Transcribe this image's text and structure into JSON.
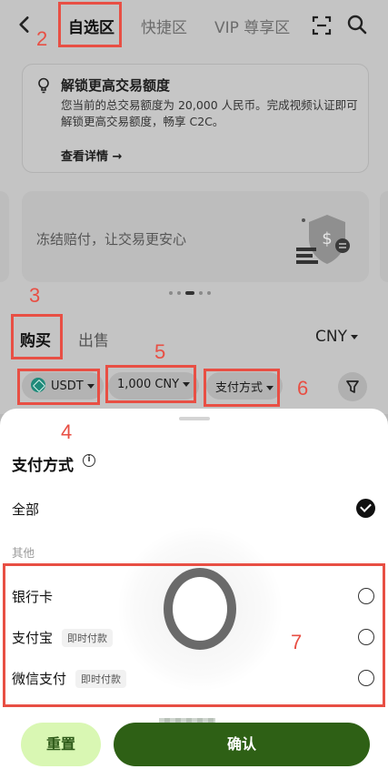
{
  "header": {
    "tabs": [
      {
        "label": "自选区",
        "active": true
      },
      {
        "label": "快捷区",
        "active": false
      },
      {
        "label": "VIP 尊享区",
        "active": false
      }
    ]
  },
  "notice": {
    "title": "解锁更高交易额度",
    "body": "您当前的总交易额度为 20,000 人民币。完成视频认证即可解锁更高交易额度，畅享 C2C。",
    "link": "查看详情 →"
  },
  "banner": {
    "text": "冻结赔付，让交易更安心",
    "page_count": 5,
    "active_page": 1
  },
  "trade": {
    "tabs": [
      {
        "label": "购买",
        "active": true
      },
      {
        "label": "出售",
        "active": false
      }
    ],
    "currency": "CNY"
  },
  "filters": {
    "coin": "USDT",
    "amount": "1,000 CNY",
    "payment": "支付方式"
  },
  "annotations": [
    "2",
    "3",
    "5",
    "6",
    "4",
    "7"
  ],
  "sheet": {
    "title": "支付方式",
    "all_label": "全部",
    "group_label": "其他",
    "options": [
      {
        "label": "银行卡",
        "tag": ""
      },
      {
        "label": "支付宝",
        "tag": "即时付款"
      },
      {
        "label": "微信支付",
        "tag": "即时付款"
      }
    ],
    "reset_label": "重置",
    "confirm_label": "确认"
  },
  "colors": {
    "brand_dark_green": "#2e6015",
    "brand_light_green": "#d9f7b3",
    "annotation_red": "#e84f44"
  }
}
